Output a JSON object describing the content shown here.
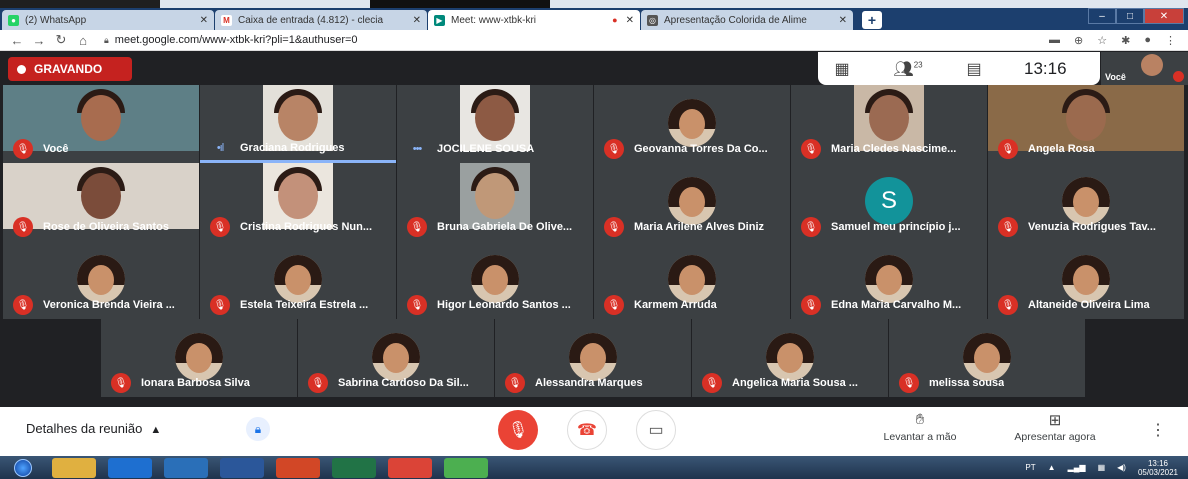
{
  "browser": {
    "tabs": [
      {
        "label": "(2) WhatsApp",
        "icon": "whatsapp-icon",
        "color": "#25d366"
      },
      {
        "label": "Caixa de entrada (4.812) - clecia",
        "icon": "gmail-icon",
        "color": "#d93025"
      },
      {
        "label": "Meet: www-xtbk-kri",
        "icon": "meet-icon",
        "color": "#00897b",
        "recording": true
      },
      {
        "label": "Apresentação Colorida de Alime",
        "icon": "canva-icon",
        "color": "#555555"
      }
    ],
    "url": "meet.google.com/www-xtbk-kri?pli=1&authuser=0"
  },
  "meet": {
    "recording_label": "GRAVANDO",
    "participant_count": "23",
    "time": "13:16",
    "self_label": "Você",
    "participants": [
      {
        "name": "Você",
        "muted": true,
        "kind": "video",
        "bg": "#5e7f86",
        "skin": "#a86c4f"
      },
      {
        "name": "Graciana Rodrigues",
        "muted": false,
        "kind": "video",
        "bg": "#e3e0d9",
        "skin": "#b88466",
        "active": true
      },
      {
        "name": "JOCILENE SOUSA",
        "muted": false,
        "kind": "video",
        "bg": "#e8e6e2",
        "skin": "#8d5a44"
      },
      {
        "name": "Geovanna Torres Da Co...",
        "muted": true,
        "kind": "avatar"
      },
      {
        "name": "Maria Cledes Nascime...",
        "muted": true,
        "kind": "video",
        "bg": "#c9b8a6",
        "skin": "#9b6a52"
      },
      {
        "name": "Angela Rosa",
        "muted": true,
        "kind": "video",
        "bg": "#8a6a48",
        "skin": "#9b6a4e"
      },
      {
        "name": "Rose de Oliveira Santos",
        "muted": true,
        "kind": "video",
        "bg": "#d9d2c9",
        "skin": "#7b4c3a"
      },
      {
        "name": "Cristina Rodrigues Nun...",
        "muted": true,
        "kind": "video",
        "bg": "#ebe6de",
        "skin": "#c3917a"
      },
      {
        "name": "Bruna Gabriela De Olive...",
        "muted": true,
        "kind": "video",
        "bg": "#9aa0a0",
        "skin": "#c09878"
      },
      {
        "name": "Maria Arilene Alves Diniz",
        "muted": true,
        "kind": "avatar"
      },
      {
        "name": "Samuel meu princípio j...",
        "muted": true,
        "kind": "letter",
        "letter": "S"
      },
      {
        "name": "Venuzia Rodrigues Tav...",
        "muted": true,
        "kind": "avatar"
      },
      {
        "name": "Veronica Brenda Vieira ...",
        "muted": true,
        "kind": "avatar"
      },
      {
        "name": "Estela Teixeira Estrela ...",
        "muted": true,
        "kind": "avatar"
      },
      {
        "name": "Higor Leonardo Santos ...",
        "muted": true,
        "kind": "avatar"
      },
      {
        "name": "Karmem Arruda",
        "muted": true,
        "kind": "avatar"
      },
      {
        "name": "Edna Maria Carvalho M...",
        "muted": true,
        "kind": "avatar"
      },
      {
        "name": "Altaneide Oliveira Lima",
        "muted": true,
        "kind": "avatar"
      },
      {
        "name": "Ionara Barbosa Silva",
        "muted": true,
        "kind": "avatar"
      },
      {
        "name": "Sabrina Cardoso Da Sil...",
        "muted": true,
        "kind": "avatar"
      },
      {
        "name": "Alessandra Marques",
        "muted": true,
        "kind": "avatar"
      },
      {
        "name": "Angelica Maria Sousa ...",
        "muted": true,
        "kind": "avatar"
      },
      {
        "name": "melissa sousa",
        "muted": true,
        "kind": "avatar"
      }
    ]
  },
  "controls": {
    "details_label": "Detalhes da reunião",
    "raise_hand_label": "Levantar a mão",
    "present_label": "Apresentar agora"
  },
  "taskbar": {
    "apps": [
      {
        "name": "explorer-icon",
        "color": "#e0b040"
      },
      {
        "name": "ie-icon",
        "color": "#1e6fd0"
      },
      {
        "name": "media-player-icon",
        "color": "#2a6fb8"
      },
      {
        "name": "word-icon",
        "color": "#2b579a"
      },
      {
        "name": "powerpoint-icon",
        "color": "#d24726"
      },
      {
        "name": "excel-icon",
        "color": "#217346"
      },
      {
        "name": "chrome-icon",
        "color": "#db4437"
      },
      {
        "name": "utorrent-icon",
        "color": "#4caf50"
      }
    ],
    "lang": "PT",
    "time": "13:16",
    "date": "05/03/2021"
  }
}
